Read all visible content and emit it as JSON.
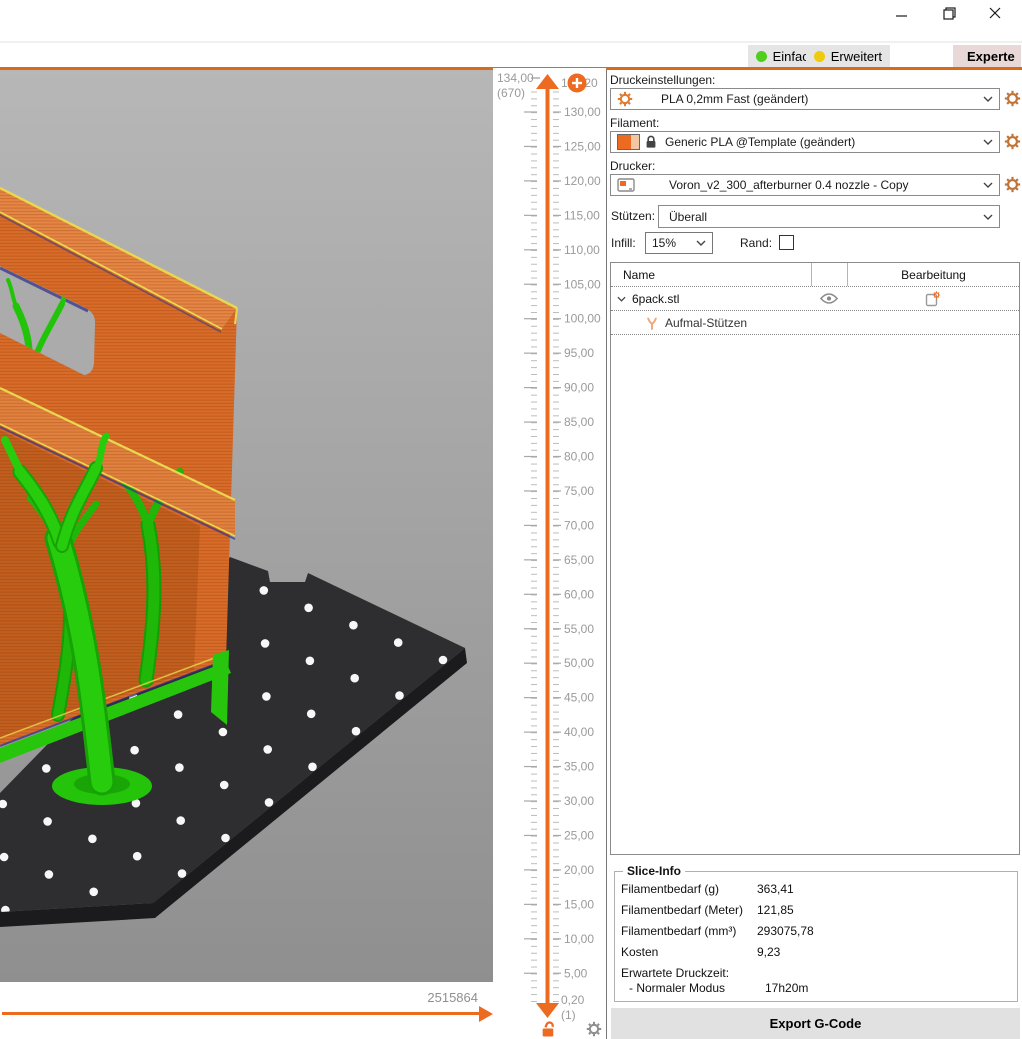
{
  "window": {
    "controls": {
      "minimize": "minimize",
      "restore": "restore",
      "close": "close"
    }
  },
  "mode_bar": {
    "modes": [
      {
        "label": "Einfach",
        "dot_color": "#4fce1f",
        "active": false
      },
      {
        "label": "Erweitert",
        "dot_color": "#eecb0e",
        "active": false
      },
      {
        "label": "Experte",
        "dot_color": "#df1212",
        "active": true
      }
    ]
  },
  "viewport": {
    "extrusion_count": "2515864"
  },
  "layer_slider": {
    "current_value": "134,00",
    "current_layer": "(670)",
    "top_tick": "134,20",
    "major_ticks": [
      "130,00",
      "125,00",
      "120,00",
      "115,00",
      "110,00",
      "105,00",
      "100,00",
      "95,00",
      "90,00",
      "85,00",
      "80,00",
      "75,00",
      "70,00",
      "65,00",
      "60,00",
      "55,00",
      "50,00",
      "45,00",
      "40,00",
      "35,00",
      "30,00",
      "25,00",
      "20,00",
      "15,00",
      "10,00",
      "5,00"
    ],
    "bottom_tick": "0,20",
    "bottom_layer": "(1)"
  },
  "settings": {
    "print_label": "Druckeinstellungen:",
    "print_value": "PLA 0,2mm Fast (geändert)",
    "filament_label": "Filament:",
    "filament_value": "Generic PLA @Template (geändert)",
    "printer_label": "Drucker:",
    "printer_value": "Voron_v2_300_afterburner 0.4 nozzle - Copy",
    "supports_label": "Stützen:",
    "supports_value": "Überall",
    "infill_label": "Infill:",
    "infill_value": "15%",
    "brim_label": "Rand:"
  },
  "object_list": {
    "columns": [
      "Name",
      "Bearbeitung"
    ],
    "rows": [
      {
        "name": "6pack.stl"
      },
      {
        "name": "Aufmal-Stützen"
      }
    ]
  },
  "slice_info": {
    "title": "Slice-Info",
    "rows": [
      {
        "label": "Filamentbedarf (g)",
        "value": "363,41"
      },
      {
        "label": "Filamentbedarf (Meter)",
        "value": "121,85"
      },
      {
        "label": "Filamentbedarf (mm³)",
        "value": "293075,78"
      },
      {
        "label": "Kosten",
        "value": "9,23"
      },
      {
        "label": "Erwartete Druckzeit:",
        "value": "",
        "compact": true
      },
      {
        "label": "- Normaler Modus",
        "value": "17h20m",
        "compact": true,
        "indent": true
      }
    ]
  },
  "export_button": "Export G-Code",
  "colors": {
    "accent": "#ED6B21",
    "model_orange": "#D96C28",
    "seam_yellow": "#E8D74F",
    "support_green": "#27C60C",
    "bed": "#2E2E30"
  }
}
